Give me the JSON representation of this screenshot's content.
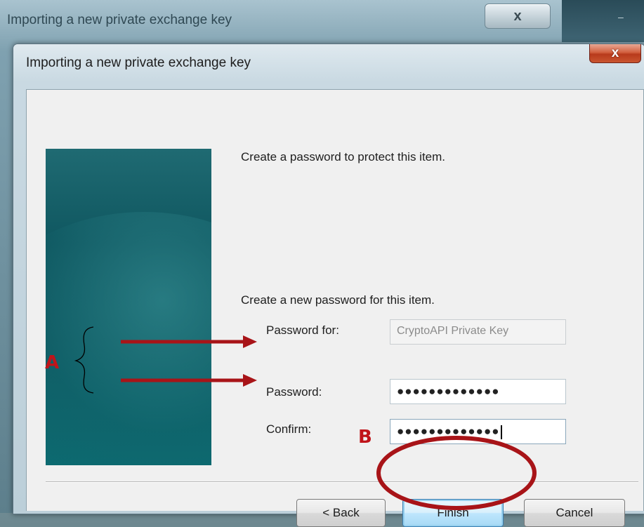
{
  "background_window": {
    "title": "Importing a new private exchange key",
    "close_glyph": "x"
  },
  "dialog": {
    "title": "Importing a new private exchange key",
    "close_glyph": "x",
    "intro": "Create a password to protect this item.",
    "section_heading": "Create a new password for this item.",
    "password_for": {
      "label": "Password for:",
      "value": "CryptoAPI Private Key"
    },
    "password": {
      "label": "Password:",
      "masked_value": "●●●●●●●●●●●●●"
    },
    "confirm": {
      "label": "Confirm:",
      "masked_value": "●●●●●●●●●●●●●"
    },
    "buttons": {
      "back": "< Back",
      "finish": "Finish",
      "cancel": "Cancel"
    }
  },
  "annotations": {
    "group_label": "A",
    "button_label": "B",
    "color": "#c0141a"
  },
  "icons": {
    "close": "close-icon",
    "arrow": "arrow-right-icon",
    "brace": "curly-brace-icon"
  }
}
